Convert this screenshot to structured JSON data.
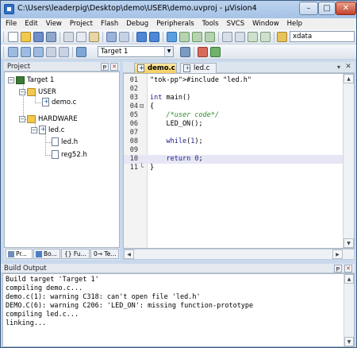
{
  "window": {
    "title": "C:\\Users\\leaderpig\\Desktop\\demo\\USER\\demo.uvproj - µVision4",
    "minimize": "–",
    "maximize": "□",
    "close": "✕"
  },
  "menu": [
    "File",
    "Edit",
    "View",
    "Project",
    "Flash",
    "Debug",
    "Peripherals",
    "Tools",
    "SVCS",
    "Window",
    "Help"
  ],
  "toolbar": {
    "find_value": "xdata",
    "target_value": "Target 1"
  },
  "project_panel": {
    "title": "Project",
    "pin": "ᵽ",
    "close": "✕",
    "tree": {
      "target": "Target 1",
      "group_user": "USER",
      "file_demo": "demo.c",
      "group_hardware": "HARDWARE",
      "file_led": "led.c",
      "file_ledh": "led.h",
      "file_reg": "reg52.h"
    },
    "tabs": [
      "Pr...",
      "Bo...",
      "{} Fu...",
      "0→ Te..."
    ]
  },
  "editor": {
    "tabs": [
      "demo.c",
      "led.c"
    ],
    "lines": [
      {
        "n": "01",
        "fold": "",
        "code": "#include \"led.h\""
      },
      {
        "n": "02",
        "fold": "",
        "code": ""
      },
      {
        "n": "03",
        "fold": "",
        "code": "int main()"
      },
      {
        "n": "04",
        "fold": "⊟",
        "code": "{"
      },
      {
        "n": "05",
        "fold": "",
        "code": "    /*user code*/"
      },
      {
        "n": "06",
        "fold": "",
        "code": "    LED_ON();"
      },
      {
        "n": "07",
        "fold": "",
        "code": ""
      },
      {
        "n": "08",
        "fold": "",
        "code": "    while(1);"
      },
      {
        "n": "09",
        "fold": "",
        "code": ""
      },
      {
        "n": "10",
        "fold": "",
        "code": "    return 0;"
      },
      {
        "n": "11",
        "fold": "└",
        "code": "}"
      }
    ]
  },
  "build_output": {
    "title": "Build Output",
    "pin": "ᵽ",
    "close": "✕",
    "lines": [
      "Build target 'Target 1'",
      "compiling demo.c...",
      "demo.c(1): warning C318: can't open file 'led.h'",
      "DEMO.C(6): warning C206: 'LED_ON': missing function-prototype",
      "compiling led.c...",
      "linking..."
    ]
  }
}
